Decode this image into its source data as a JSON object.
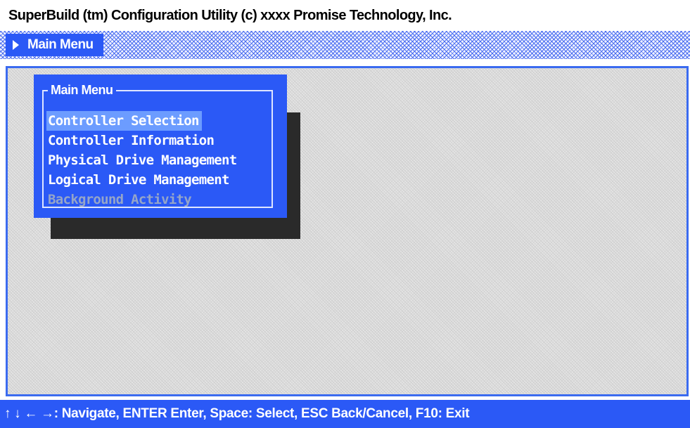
{
  "window": {
    "title": "SuperBuild (tm) Configuration Utility (c) xxxx Promise Technology, Inc."
  },
  "breadcrumb": {
    "label": "Main Menu",
    "icon": "triangle-right-icon"
  },
  "menu": {
    "title": "Main Menu",
    "items": [
      {
        "label": "Controller Selection",
        "state": "selected"
      },
      {
        "label": "Controller Information",
        "state": "normal"
      },
      {
        "label": "Physical Drive Management",
        "state": "normal"
      },
      {
        "label": "Logical Drive Management",
        "state": "normal"
      },
      {
        "label": "Background Activity",
        "state": "disabled"
      }
    ]
  },
  "statusbar": {
    "hint": "↑ ↓ ← →: Navigate, ENTER Enter, Space: Select, ESC Back/Cancel, F10: Exit"
  },
  "colors": {
    "accent": "#2b59f6",
    "highlight": "#6c9cff",
    "disabled": "#95a5c8",
    "shadow": "#2a2a2a",
    "workspace": "#e4e4e4"
  }
}
